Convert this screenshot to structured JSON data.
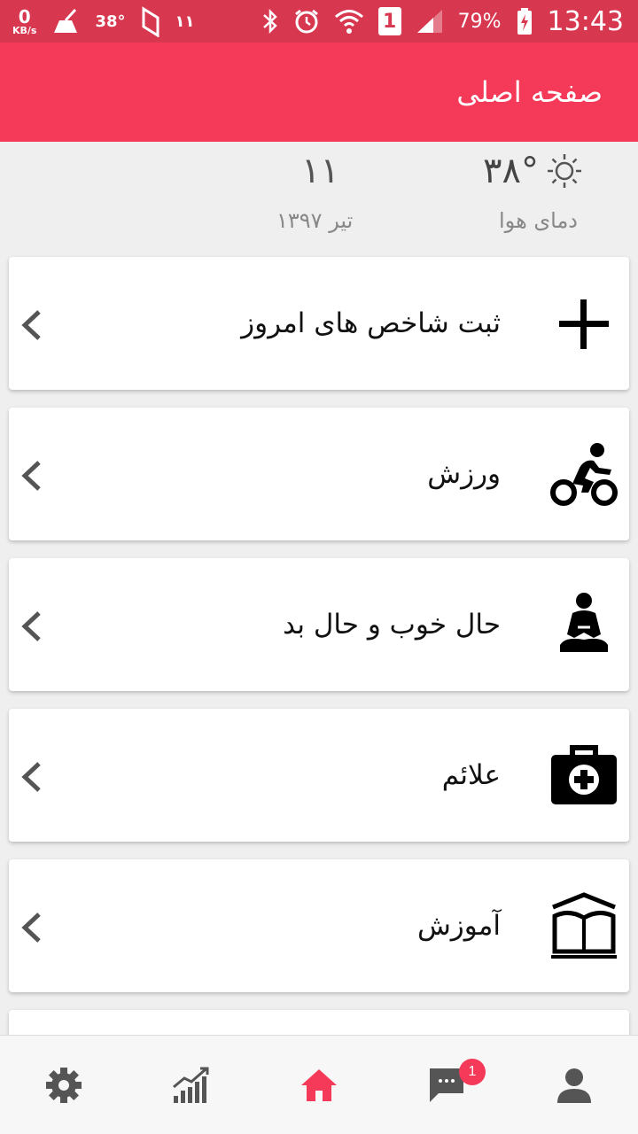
{
  "status_bar": {
    "net_speed": "0",
    "net_unit": "KB/s",
    "temp": "38°",
    "notification_count": "۱۱",
    "sim": "1",
    "battery": "79%",
    "time": "13:43"
  },
  "app_bar": {
    "title": "صفحه اصلی"
  },
  "info": {
    "temperature": "۳۸°",
    "weather_label": "دمای هوا",
    "day": "۱۱",
    "month_year": "تیر ۱۳۹۷"
  },
  "cards": [
    {
      "label": "ثبت شاخص های امروز",
      "icon": "plus-icon"
    },
    {
      "label": "ورزش",
      "icon": "cycling-icon"
    },
    {
      "label": "حال خوب و حال بد",
      "icon": "meditation-icon"
    },
    {
      "label": "علائم",
      "icon": "medical-kit-icon"
    },
    {
      "label": "آموزش",
      "icon": "book-icon"
    }
  ],
  "bottom_nav": {
    "items": [
      "settings-icon",
      "chart-icon",
      "home-icon",
      "chat-icon",
      "profile-icon"
    ],
    "chat_badge": "1",
    "active_color": "#f43a58",
    "inactive_color": "#555555"
  },
  "colors": {
    "accent": "#f43a58",
    "status_bar": "#d7374f"
  }
}
